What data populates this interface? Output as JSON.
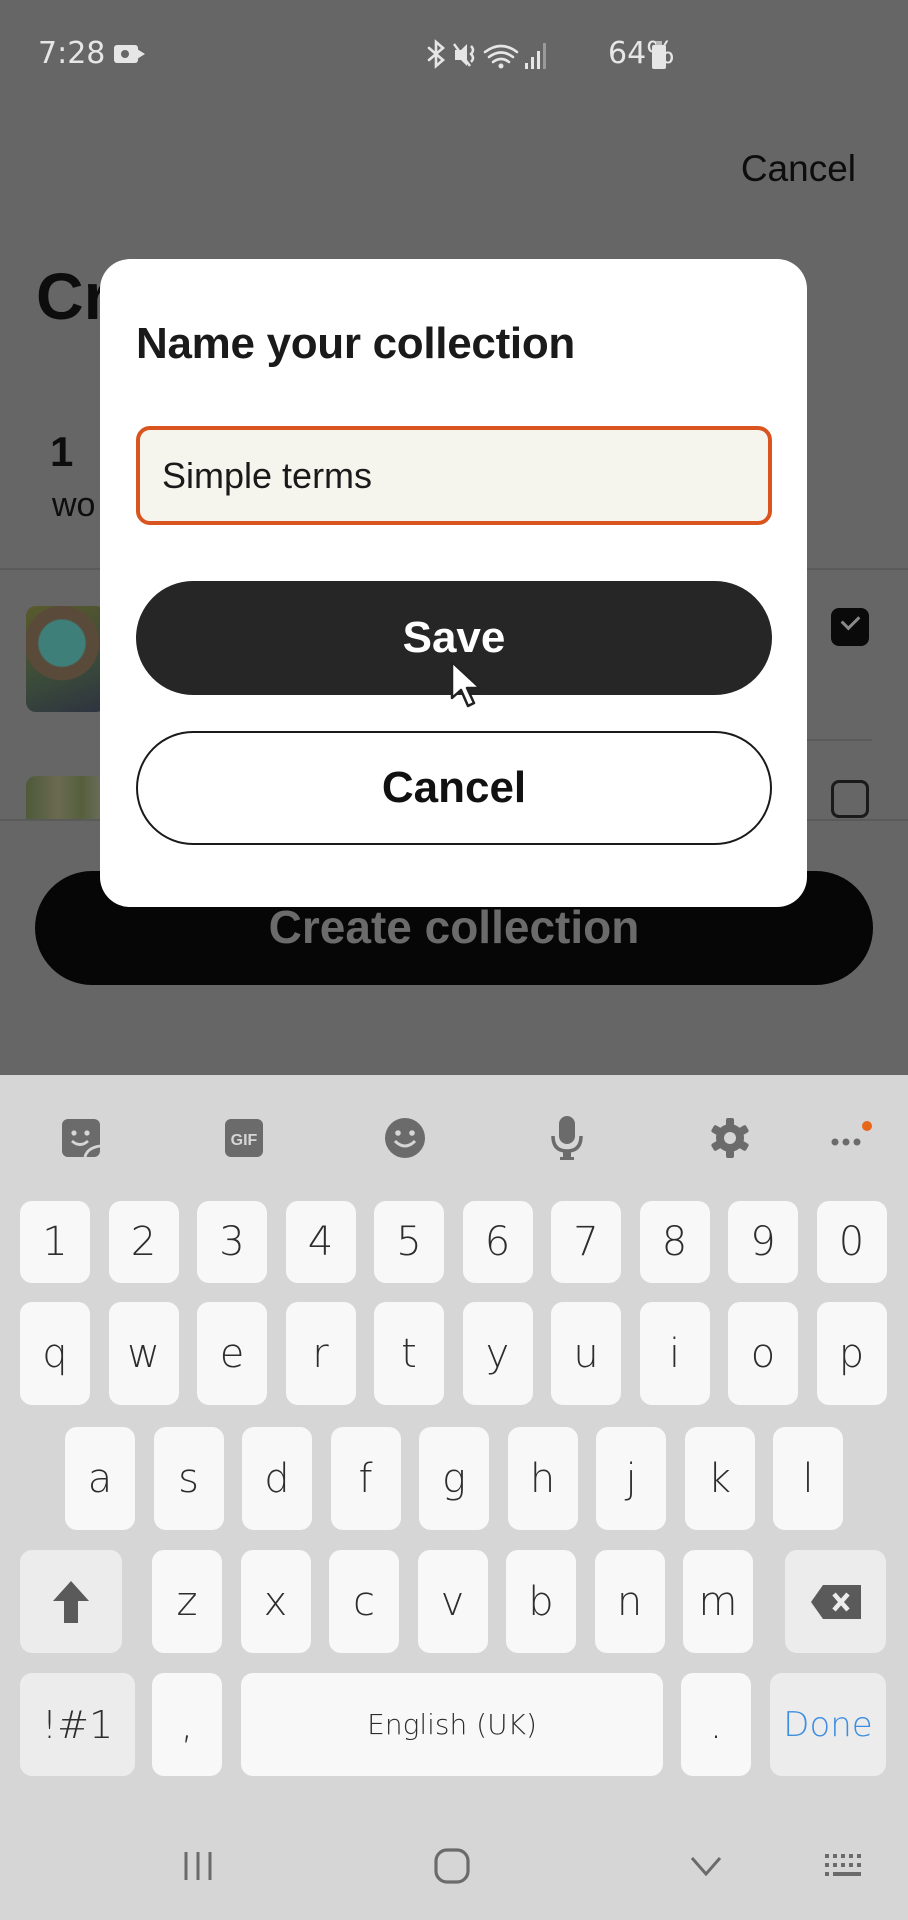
{
  "status_bar": {
    "time": "7:28",
    "recording_icon": "video-recording-icon",
    "icons": [
      "bluetooth-icon",
      "vibrate-mute-icon",
      "wifi-icon",
      "signal-icon"
    ],
    "icon_glyphs": "✱ ♪ ≋ .ıl",
    "battery_percent": "64%",
    "battery_icon": "battery-icon"
  },
  "background_page": {
    "cancel_label": "Cancel",
    "title_visible": "Cr",
    "count": "1",
    "count_label_visible": "wo",
    "items": [
      {
        "thumbnail": "photo-thumbnail",
        "checked": true
      },
      {
        "thumbnail": "photo-thumbnail",
        "checked": false
      }
    ],
    "create_button_label": "Create collection"
  },
  "dialog": {
    "title": "Name your collection",
    "input_value": "Simple terms",
    "save_label": "Save",
    "cancel_label": "Cancel",
    "accent_color": "#d9541e"
  },
  "keyboard": {
    "toolbar": [
      "sticker-icon",
      "gif-icon",
      "emoji-icon",
      "microphone-icon",
      "settings-icon",
      "more-icon"
    ],
    "gif_label": "GIF",
    "number_row": [
      "1",
      "2",
      "3",
      "4",
      "5",
      "6",
      "7",
      "8",
      "9",
      "0"
    ],
    "row1": [
      "q",
      "w",
      "e",
      "r",
      "t",
      "y",
      "u",
      "i",
      "o",
      "p"
    ],
    "row2": [
      "a",
      "s",
      "d",
      "f",
      "g",
      "h",
      "j",
      "k",
      "l"
    ],
    "row3": [
      "z",
      "x",
      "c",
      "v",
      "b",
      "n",
      "m"
    ],
    "symbols_label": "!#1",
    "comma_label": ",",
    "space_label": "English (UK)",
    "period_label": ".",
    "done_label": "Done",
    "done_color": "#3d8de0",
    "notification_dot_color": "#e8661a"
  },
  "nav_bar": {
    "buttons": [
      "recent-apps-icon",
      "home-icon",
      "back-icon",
      "keyboard-switch-icon"
    ]
  }
}
